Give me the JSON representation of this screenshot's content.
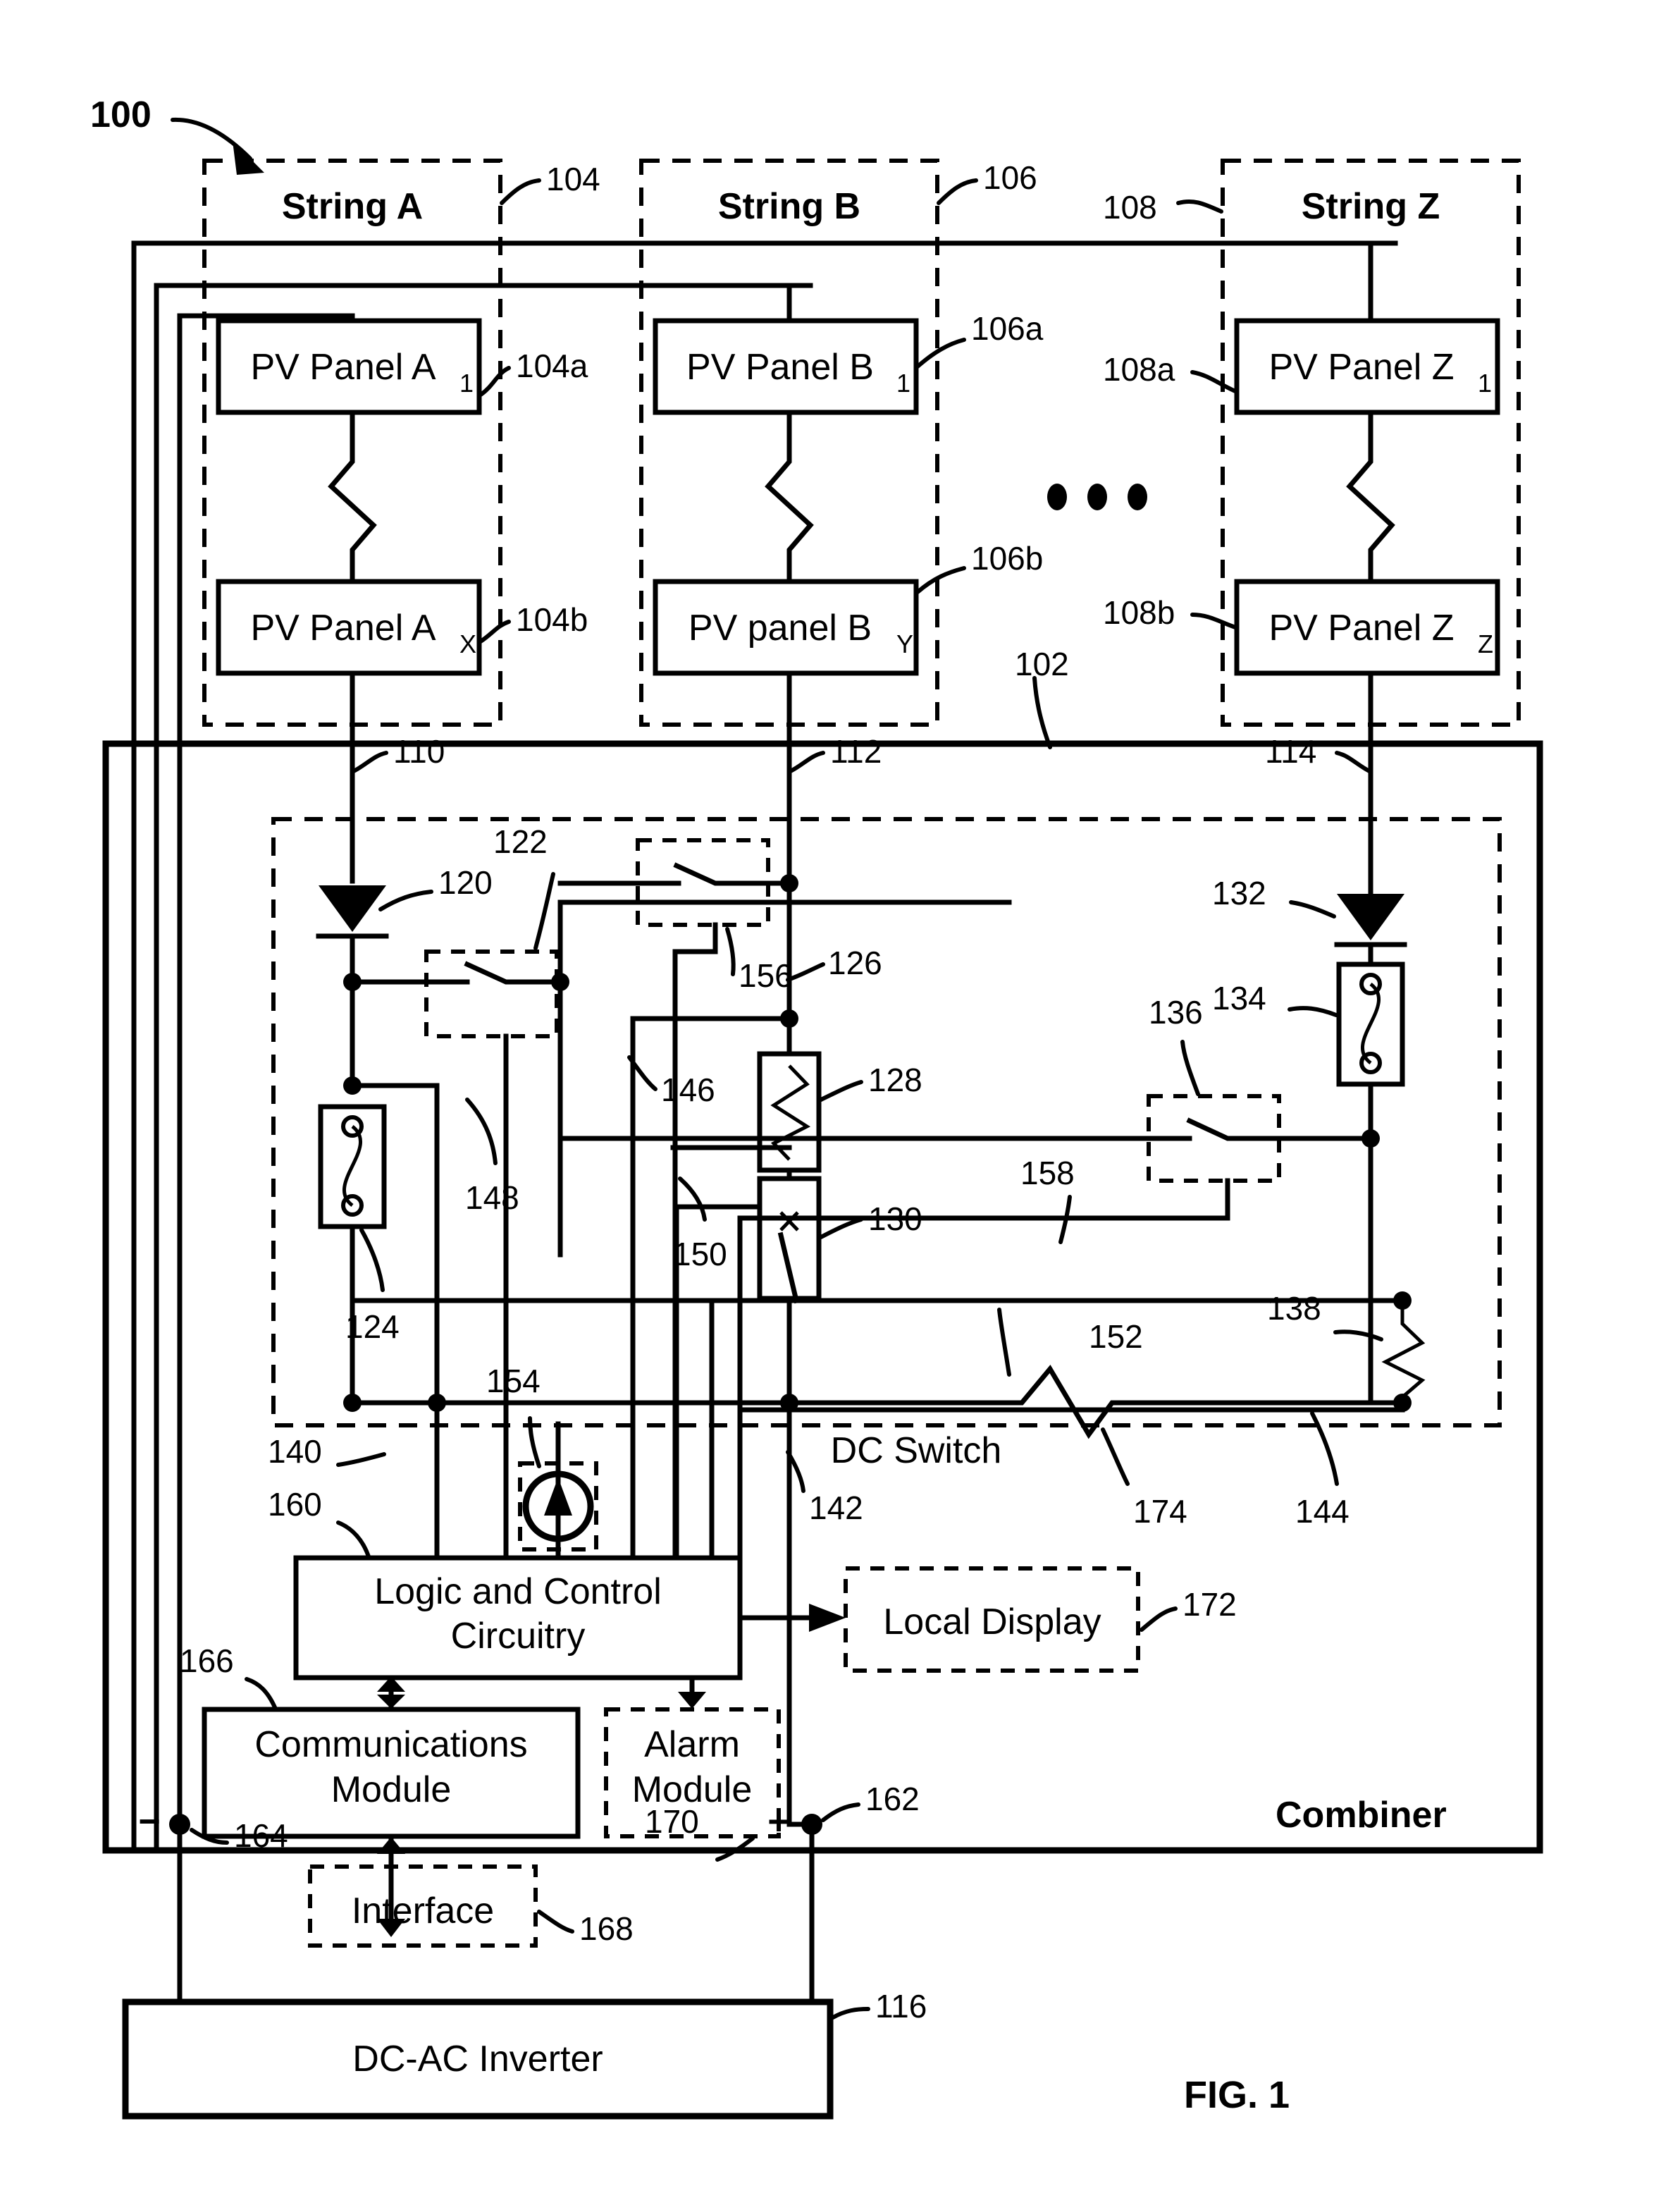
{
  "figure": {
    "caption": "FIG. 1",
    "system_ref": "100"
  },
  "strings": [
    {
      "title": "String A",
      "ref": "104",
      "top_panel": {
        "label": "PV Panel A",
        "subscript": "1",
        "ref": "104a"
      },
      "bottom_panel": {
        "label": "PV Panel A",
        "subscript": "X",
        "ref": "104b"
      },
      "feed_ref": "110"
    },
    {
      "title": "String B",
      "ref": "106",
      "top_panel": {
        "label": "PV Panel B",
        "subscript": "1",
        "ref": "106a"
      },
      "bottom_panel": {
        "label": "PV panel B",
        "subscript": "Y",
        "ref": "106b"
      },
      "feed_ref": "112"
    },
    {
      "title": "String Z",
      "ref": "108",
      "top_panel": {
        "label": "PV Panel Z",
        "subscript": "1",
        "ref": "108a"
      },
      "bottom_panel": {
        "label": "PV Panel Z",
        "subscript": "Z",
        "ref": "108b"
      },
      "feed_ref": "114"
    }
  ],
  "ellipsis": "•  •  •",
  "combiner": {
    "label": "Combiner",
    "ref": "102",
    "dc_switch_label": "DC Switch",
    "dc_switch_ref": "142",
    "inner_block_ref": "174",
    "terminals": {
      "negative_sign": "−",
      "negative_ref": "164",
      "positive_sign": "+",
      "positive_ref": "162"
    }
  },
  "components": [
    {
      "ref": "120",
      "name": "blocking-diode-a"
    },
    {
      "ref": "122",
      "name": "switch-a"
    },
    {
      "ref": "124",
      "name": "fuse-a"
    },
    {
      "ref": "126",
      "name": "node-b"
    },
    {
      "ref": "128",
      "name": "resistor-128"
    },
    {
      "ref": "130",
      "name": "fuse-switch-130"
    },
    {
      "ref": "132",
      "name": "blocking-diode-z"
    },
    {
      "ref": "134",
      "name": "fuse-z"
    },
    {
      "ref": "136",
      "name": "switch-z"
    },
    {
      "ref": "138",
      "name": "resistor-138"
    },
    {
      "ref": "140",
      "name": "bus-140"
    },
    {
      "ref": "144",
      "name": "line-144"
    },
    {
      "ref": "146",
      "name": "line-146"
    },
    {
      "ref": "148",
      "name": "line-148"
    },
    {
      "ref": "150",
      "name": "line-150"
    },
    {
      "ref": "152",
      "name": "current-sensor-152"
    },
    {
      "ref": "154",
      "name": "line-154"
    },
    {
      "ref": "156",
      "name": "line-156"
    },
    {
      "ref": "158",
      "name": "line-158"
    }
  ],
  "blocks": {
    "logic": {
      "line1": "Logic and Control",
      "line2": "Circuitry",
      "ref": "160"
    },
    "communications": {
      "line1": "Communications",
      "line2": "Module",
      "ref": "166"
    },
    "alarm": {
      "line1": "Alarm",
      "line2": "Module",
      "ref": "170"
    },
    "local_display": {
      "label": "Local Display",
      "ref": "172"
    },
    "interface": {
      "label": "Interface",
      "ref": "168"
    },
    "inverter": {
      "label": "DC-AC Inverter",
      "ref": "116"
    }
  },
  "colors": {
    "ink": "#000000",
    "paper": "#ffffff"
  }
}
